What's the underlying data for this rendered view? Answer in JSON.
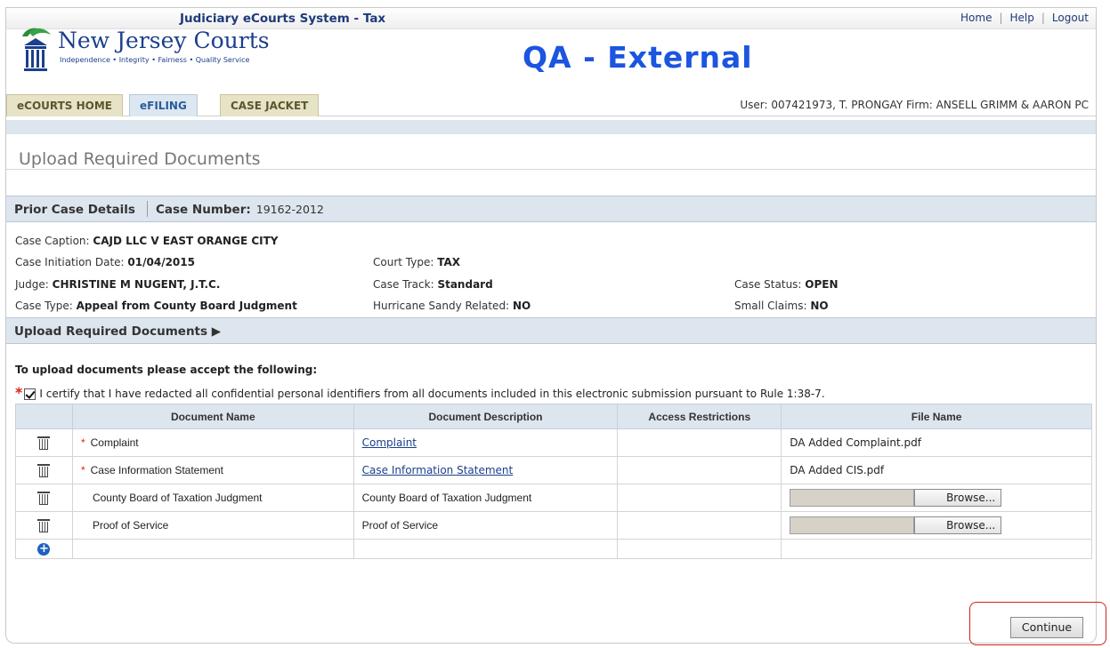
{
  "header": {
    "system_title": "Judiciary eCourts System - Tax",
    "links": {
      "home": "Home",
      "help": "Help",
      "logout": "Logout"
    },
    "logo_name": "New Jersey Courts",
    "logo_tagline": "Independence • Integrity • Fairness • Quality Service",
    "env_title": "QA - External"
  },
  "nav": {
    "tabs": [
      {
        "label": "eCOURTS HOME"
      },
      {
        "label": "eFILING"
      },
      {
        "label": "CASE JACKET"
      }
    ],
    "user_info": "User: 007421973, T. PRONGAY  Firm: ANSELL GRIMM & AARON PC"
  },
  "page": {
    "title": "Upload Required Documents"
  },
  "prior_case": {
    "section_label": "Prior Case Details",
    "case_number_label": "Case Number:",
    "case_number": "19162-2012",
    "details": {
      "caption_label": "Case Caption:",
      "caption": "CAJD LLC V EAST ORANGE CITY",
      "initiation_label": "Case Initiation Date:",
      "initiation": "01/04/2015",
      "court_type_label": "Court Type:",
      "court_type": "TAX",
      "judge_label": "Judge:",
      "judge": "CHRISTINE M NUGENT, J.T.C.",
      "track_label": "Case Track:",
      "track": "Standard",
      "status_label": "Case Status:",
      "status": "OPEN",
      "type_label": "Case Type:",
      "type": "Appeal from County Board Judgment",
      "sandy_label": "Hurricane Sandy Related:",
      "sandy": "NO",
      "small_label": "Small Claims:",
      "small": "NO"
    }
  },
  "upload": {
    "section_label": "Upload Required Documents ▶",
    "accept_heading": "To upload documents please accept the following:",
    "certify_text": "I certify that I have redacted all confidential personal identifiers from all documents included in this electronic submission pursuant to Rule 1:38-7.",
    "columns": {
      "name": "Document Name",
      "description": "Document Description",
      "access": "Access Restrictions",
      "file": "File Name"
    },
    "rows": [
      {
        "name": "Complaint",
        "description": "Complaint",
        "access": "",
        "file": "DA Added Complaint.pdf"
      },
      {
        "name": "Case Information Statement",
        "description": "Case Information Statement",
        "access": "",
        "file": "DA Added CIS.pdf"
      },
      {
        "name": "County Board of Taxation Judgment",
        "description": "County Board of Taxation Judgment",
        "access": "",
        "browse": "Browse..."
      },
      {
        "name": "Proof of Service",
        "description": "Proof of Service",
        "access": "",
        "browse": "Browse..."
      }
    ],
    "continue_label": "Continue"
  }
}
